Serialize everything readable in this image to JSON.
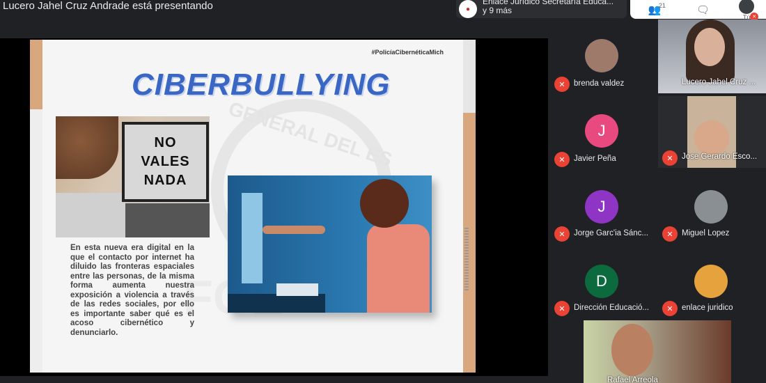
{
  "header": {
    "presenting_text": "Lucero Jahel Cruz Andrade está presentando",
    "meeting_name": "Enlace Jurídico Secretaría Educa...",
    "meeting_more": "y 9 más",
    "participants_count": "21",
    "self_label": "Tú"
  },
  "slide": {
    "hashtag": "#PolicíaCibernéticaMich",
    "title": "CIBERBULLYING",
    "image_text_lines": [
      "NO",
      "VALES",
      "NADA"
    ],
    "watermark_line": "GENERAL DEL ES",
    "watermark_big": "FGE",
    "body_text": "En esta nueva era digital en la que el contacto por internet ha diluido las fronteras espaciales entre las personas, de la misma forma aumenta nuestra exposición a violencia a través de las redes sociales, por ello es importante saber qué es el acoso cibernético y denunciarlo."
  },
  "participants": [
    {
      "name": "brenda valdez",
      "initial": "",
      "color": "#9e7a6a"
    },
    {
      "name": "Lucero Jahel Cruz ...",
      "initial": "",
      "color": "#6b6f78"
    },
    {
      "name": "Javier Peña",
      "initial": "J",
      "color": "#e84a7f"
    },
    {
      "name": "Jose Gerardo Esco...",
      "initial": "",
      "color": "#a08a6a"
    },
    {
      "name": "Jorge Garc'ia Sánc...",
      "initial": "J",
      "color": "#8e35c6"
    },
    {
      "name": "Miguel Lopez",
      "initial": "",
      "color": "#8a8f94"
    },
    {
      "name": "Dirección Educació...",
      "initial": "D",
      "color": "#0b6b3e"
    },
    {
      "name": "enlace juridico",
      "initial": "",
      "color": "#e6a23c"
    },
    {
      "name": "Rafael Arreola",
      "initial": "",
      "color": "#7a5a4a"
    }
  ],
  "icons": {
    "muted": "mic-off-icon",
    "people": "people-icon",
    "chat": "chat-icon"
  }
}
